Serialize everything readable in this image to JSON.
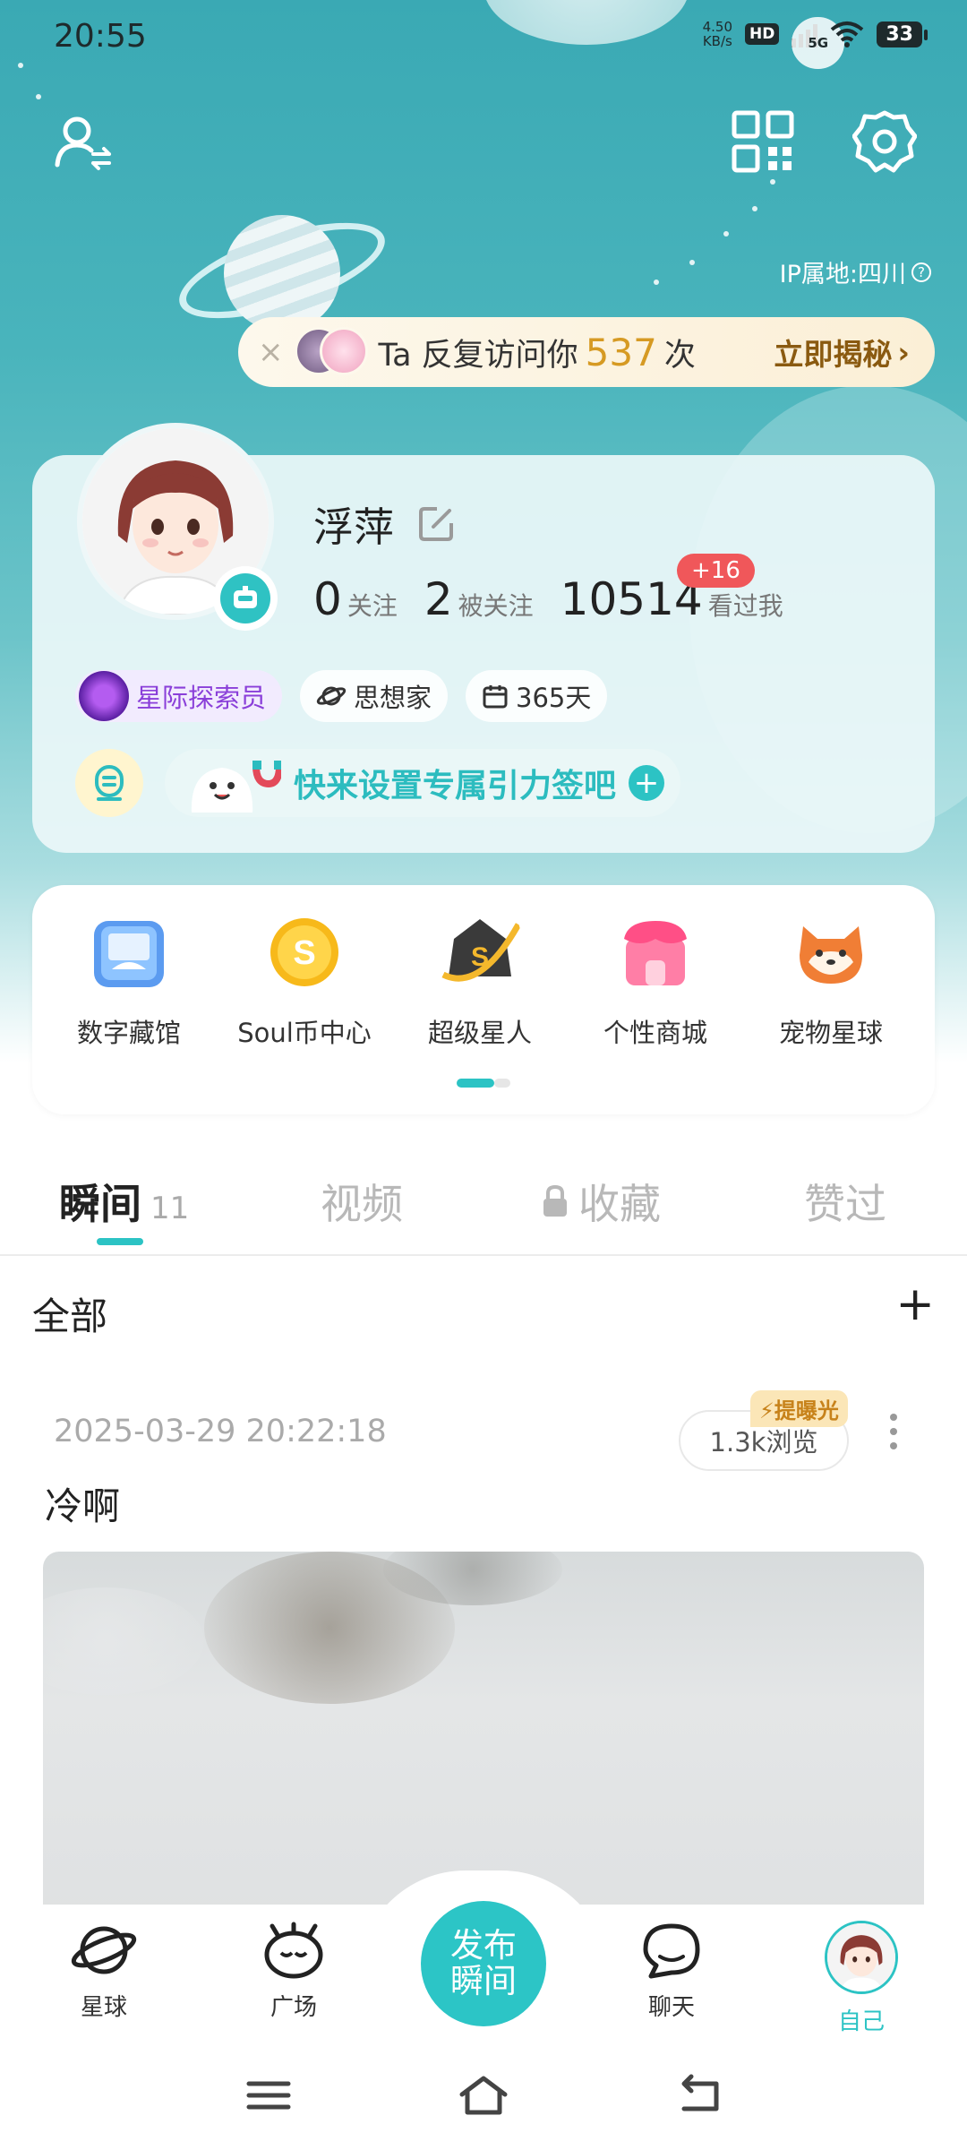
{
  "status_bar": {
    "time": "20:55",
    "net_speed_value": "4.50",
    "net_speed_unit": "KB/s",
    "hd": "HD",
    "signal": "5G",
    "battery": "33"
  },
  "header": {
    "ip_location": "IP属地:四川",
    "ip_help_icon": "?"
  },
  "visit_banner": {
    "close": "×",
    "prefix": "Ta 反复访问你",
    "count": "537",
    "suffix": "次",
    "cta": "立即揭秘",
    "cta_arrow": "›"
  },
  "profile": {
    "nickname": "浮萍",
    "following_count": "0",
    "following_label": "关注",
    "followers_count": "2",
    "followers_label": "被关注",
    "visitors_count": "10514",
    "visitors_label": "看过我",
    "visitors_new": "+16",
    "tags": {
      "explorer": "星际探索员",
      "thinker": "思想家",
      "days": "365天"
    },
    "signature_prompt": "快来设置专属引力签吧",
    "signature_plus": "+"
  },
  "features": [
    {
      "label": "数字藏馆",
      "icon": "digital-collection-icon"
    },
    {
      "label": "Soul币中心",
      "icon": "soul-coin-icon"
    },
    {
      "label": "超级星人",
      "icon": "super-star-icon"
    },
    {
      "label": "个性商城",
      "icon": "mall-icon"
    },
    {
      "label": "宠物星球",
      "icon": "pet-planet-icon"
    }
  ],
  "coin_symbol": "S",
  "tabs": {
    "moments": "瞬间",
    "moments_count": "11",
    "video": "视频",
    "favorites": "收藏",
    "liked": "赞过"
  },
  "filter": {
    "label": "全部",
    "add": "+"
  },
  "post": {
    "date": "2025-03-29 20:22:18",
    "views": "1.3k浏览",
    "boost": "提曝光",
    "text": "冷啊"
  },
  "bottom_nav": {
    "planet": "星球",
    "square": "广场",
    "publish_line1": "发布",
    "publish_line2": "瞬间",
    "chat": "聊天",
    "me": "自己"
  },
  "colors": {
    "accent": "#2cc3c4",
    "badge_red": "#f0575a",
    "count_gold": "#d69a23"
  }
}
